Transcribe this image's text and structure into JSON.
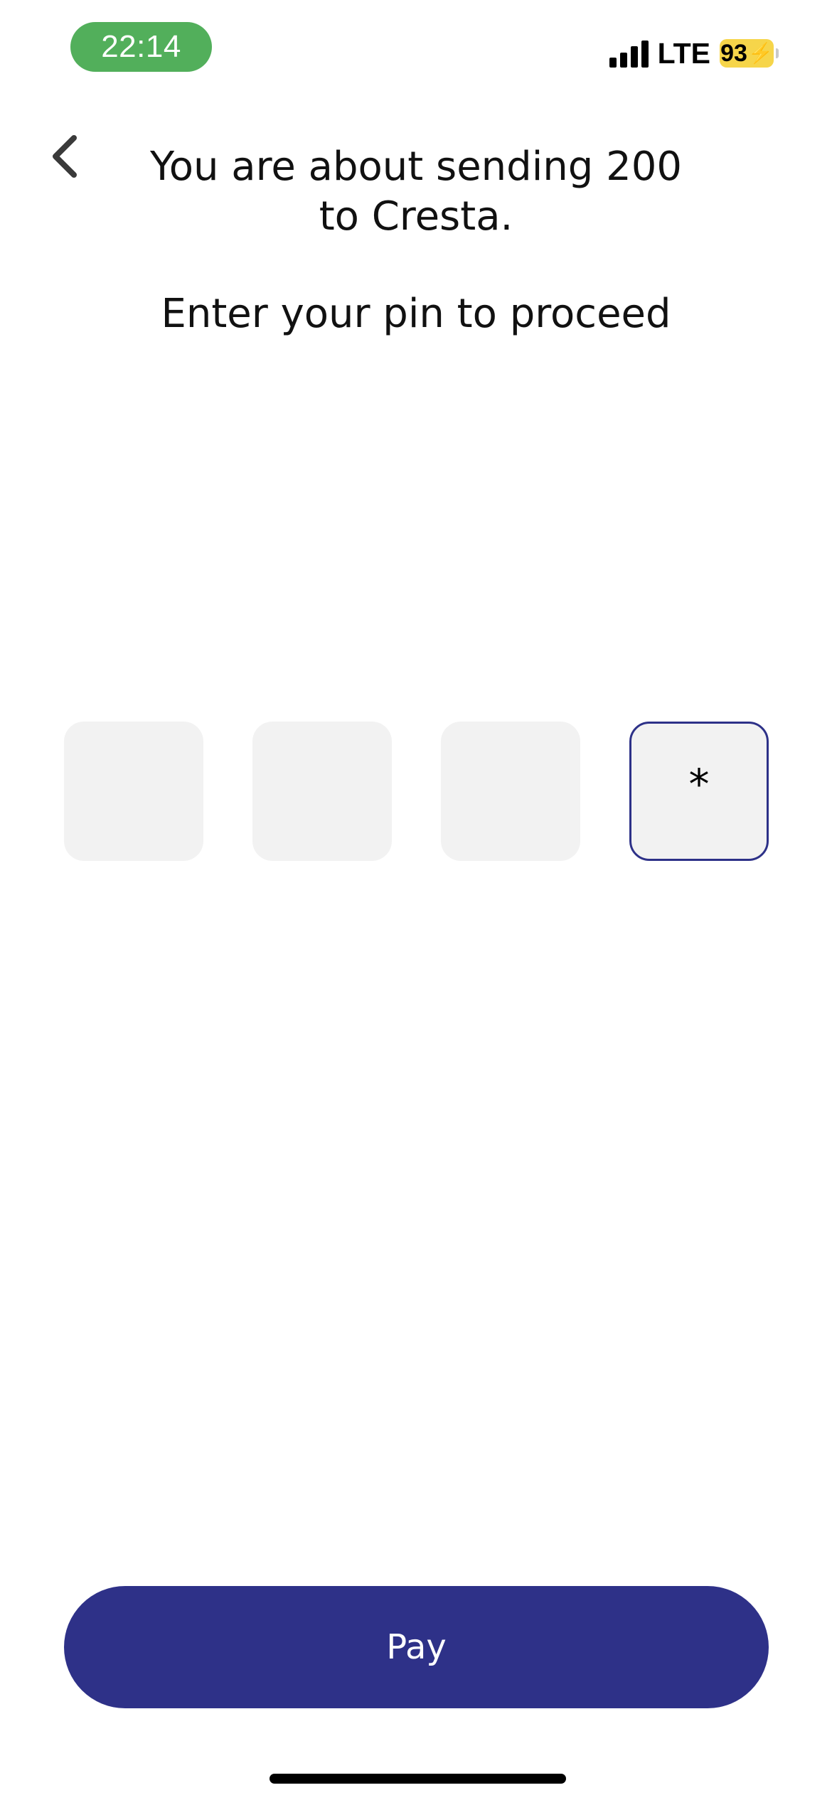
{
  "status_bar": {
    "time": "22:14",
    "network": "LTE",
    "battery_level": "93",
    "battery_charging_glyph": "⚡",
    "time_pill_color": "#52af5b",
    "battery_color": "#f6d54a"
  },
  "header": {
    "back_icon": "chevron-left-icon",
    "title_line1": "You are about sending 200",
    "title_line2": "to Cresta.",
    "subtitle": "Enter your pin to proceed"
  },
  "pin": {
    "boxes": [
      "",
      "",
      "",
      "*"
    ],
    "active_index": 3,
    "box_color": "#f2f2f2",
    "active_border_color": "#2d3188"
  },
  "actions": {
    "pay_label": "Pay",
    "pay_color": "#2e3188"
  }
}
